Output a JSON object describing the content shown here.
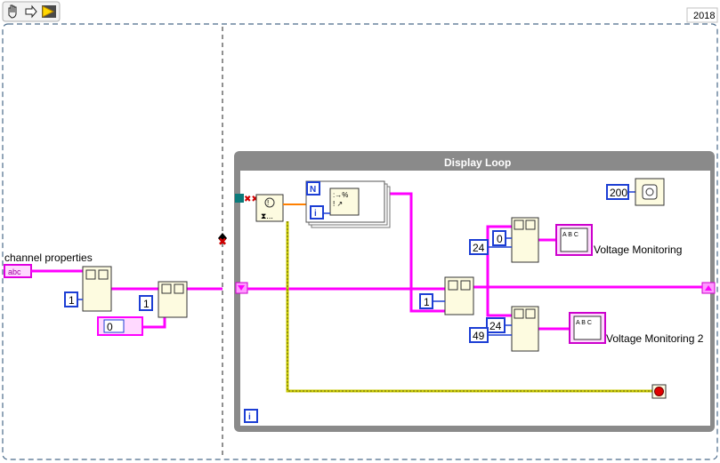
{
  "toolbar": {
    "hand_icon": "hand-icon",
    "arrow_icon": "arrow-right-icon",
    "run_icon": "run-vi-icon"
  },
  "version_badge": "2018",
  "labels": {
    "channel_properties": "channel properties",
    "voltage_monitoring": "Voltage Monitoring",
    "voltage_monitoring_2": "Voltage Monitoring 2",
    "display_loop": "Display Loop"
  },
  "constants": {
    "index_left": "1",
    "index_mid": "1",
    "zero_left": "0",
    "wait_ms": "200",
    "subset_index": "1",
    "start_0": "0",
    "len_24_a": "24",
    "len_24_b": "24",
    "start_49": "49"
  },
  "terminals": {
    "for_loop_count": "N",
    "for_loop_iteration": "i",
    "while_loop_iteration": "i",
    "string_terminal": "abc"
  },
  "colors": {
    "wire_string": "#ff00ff",
    "wire_bool": "#008000",
    "wire_int": "#1c3ed4",
    "wire_error": "#c8c800",
    "loop_frame": "#808080",
    "node_fill": "#fdfbe0",
    "stop_button": "#e00000"
  }
}
